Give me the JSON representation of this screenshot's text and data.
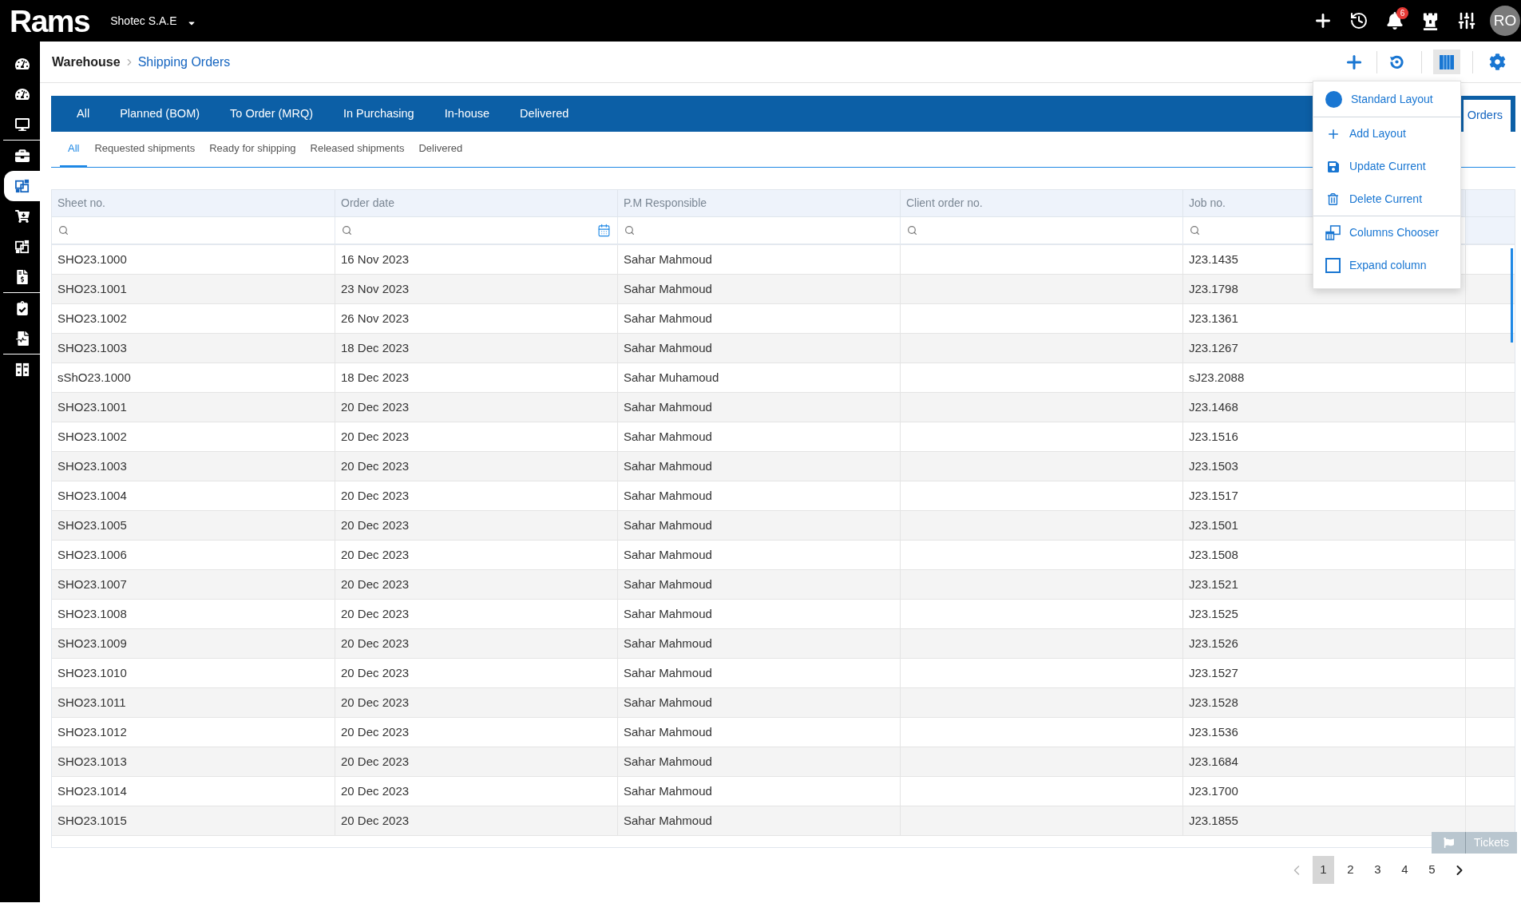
{
  "top_bar": {
    "logo": "Rams",
    "company": "Shotec S.A.E",
    "notifications_badge": "6",
    "avatar_initials": "RO"
  },
  "sidebar": {
    "groups": [
      {
        "items": [
          {
            "selected": false
          },
          {
            "selected": false
          },
          {
            "selected": false
          }
        ]
      },
      {
        "items": [
          {
            "selected": false
          },
          {
            "selected": true
          },
          {
            "selected": false
          },
          {
            "selected": false
          },
          {
            "selected": false
          }
        ]
      },
      {
        "items": [
          {
            "selected": false
          },
          {
            "selected": false
          }
        ]
      },
      {
        "items": [
          {
            "selected": false
          }
        ]
      }
    ]
  },
  "breadcrumb": [
    "Warehouse",
    "Shipping Orders"
  ],
  "status_tabs": [
    {
      "label": "All",
      "selected": false
    },
    {
      "label": "Planned (BOM)",
      "selected": false
    },
    {
      "label": "To Order (MRQ)",
      "selected": false
    },
    {
      "label": "In Purchasing",
      "selected": false
    },
    {
      "label": "In-house",
      "selected": false
    },
    {
      "label": "Delivered",
      "selected": false
    },
    {
      "label": "Orders",
      "selected": true
    }
  ],
  "sub_tabs": [
    {
      "label": "All",
      "selected": true
    },
    {
      "label": "Requested shipments",
      "selected": false
    },
    {
      "label": "Ready for shipping",
      "selected": false
    },
    {
      "label": "Released shipments",
      "selected": false
    },
    {
      "label": "Delivered",
      "selected": false
    }
  ],
  "table": {
    "columns": [
      "Sheet no.",
      "Order date",
      "P.M Responsible",
      "Client order no.",
      "Job no."
    ],
    "rows": [
      {
        "sheet_no": "SHO23.1000",
        "order_date": "16 Nov 2023",
        "pm_responsible": "Sahar Mahmoud",
        "job_no": "J23.1435"
      },
      {
        "sheet_no": "SHO23.1001",
        "order_date": "23 Nov 2023",
        "pm_responsible": "Sahar Mahmoud",
        "job_no": "J23.1798"
      },
      {
        "sheet_no": "SHO23.1002",
        "order_date": "26 Nov 2023",
        "pm_responsible": "Sahar Mahmoud",
        "job_no": "J23.1361"
      },
      {
        "sheet_no": "SHO23.1003",
        "order_date": "18 Dec 2023",
        "pm_responsible": "Sahar Mahmoud",
        "job_no": "J23.1267"
      },
      {
        "sheet_no": "sShO23.1000",
        "order_date": "18 Dec 2023",
        "pm_responsible": "Sahar Muhamoud",
        "job_no": "sJ23.2088"
      },
      {
        "sheet_no": "SHO23.1001",
        "order_date": "20 Dec 2023",
        "pm_responsible": "Sahar Mahmoud",
        "job_no": "J23.1468"
      },
      {
        "sheet_no": "SHO23.1002",
        "order_date": "20 Dec 2023",
        "pm_responsible": "Sahar Mahmoud",
        "job_no": "J23.1516"
      },
      {
        "sheet_no": "SHO23.1003",
        "order_date": "20 Dec 2023",
        "pm_responsible": "Sahar Mahmoud",
        "job_no": "J23.1503"
      },
      {
        "sheet_no": "SHO23.1004",
        "order_date": "20 Dec 2023",
        "pm_responsible": "Sahar Mahmoud",
        "job_no": "J23.1517"
      },
      {
        "sheet_no": "SHO23.1005",
        "order_date": "20 Dec 2023",
        "pm_responsible": "Sahar Mahmoud",
        "job_no": "J23.1501"
      },
      {
        "sheet_no": "SHO23.1006",
        "order_date": "20 Dec 2023",
        "pm_responsible": "Sahar Mahmoud",
        "job_no": "J23.1508"
      },
      {
        "sheet_no": "SHO23.1007",
        "order_date": "20 Dec 2023",
        "pm_responsible": "Sahar Mahmoud",
        "job_no": "J23.1521"
      },
      {
        "sheet_no": "SHO23.1008",
        "order_date": "20 Dec 2023",
        "pm_responsible": "Sahar Mahmoud",
        "job_no": "J23.1525"
      },
      {
        "sheet_no": "SHO23.1009",
        "order_date": "20 Dec 2023",
        "pm_responsible": "Sahar Mahmoud",
        "job_no": "J23.1526"
      },
      {
        "sheet_no": "SHO23.1010",
        "order_date": "20 Dec 2023",
        "pm_responsible": "Sahar Mahmoud",
        "job_no": "J23.1527"
      },
      {
        "sheet_no": "SHO23.1011",
        "order_date": "20 Dec 2023",
        "pm_responsible": "Sahar Mahmoud",
        "job_no": "J23.1528"
      },
      {
        "sheet_no": "SHO23.1012",
        "order_date": "20 Dec 2023",
        "pm_responsible": "Sahar Mahmoud",
        "job_no": "J23.1536"
      },
      {
        "sheet_no": "SHO23.1013",
        "order_date": "20 Dec 2023",
        "pm_responsible": "Sahar Mahmoud",
        "job_no": "J23.1684"
      },
      {
        "sheet_no": "SHO23.1014",
        "order_date": "20 Dec 2023",
        "pm_responsible": "Sahar Mahmoud",
        "job_no": "J23.1700"
      },
      {
        "sheet_no": "SHO23.1015",
        "order_date": "20 Dec 2023",
        "pm_responsible": "Sahar Mahmoud",
        "job_no": "J23.1855"
      }
    ]
  },
  "pagination": {
    "previous": {
      "disabled": true
    },
    "pages": [
      {
        "label": "1",
        "selected": true
      },
      {
        "label": "2",
        "selected": false
      },
      {
        "label": "3",
        "selected": false
      },
      {
        "label": "4",
        "selected": false
      },
      {
        "label": "5",
        "selected": false
      }
    ],
    "next": {
      "disabled": false
    }
  },
  "tickets_button": {
    "label": "Tickets"
  },
  "layout_menu": {
    "open": true,
    "sections": [
      {
        "items": [
          {
            "kind": "radio",
            "label": "Standard Layout",
            "selected": true
          }
        ]
      },
      {
        "items": [
          {
            "kind": "command",
            "label": "Add Layout"
          },
          {
            "kind": "command",
            "label": "Update Current"
          },
          {
            "kind": "command",
            "label": "Delete Current"
          }
        ]
      },
      {
        "items": [
          {
            "kind": "command",
            "label": "Columns Chooser"
          },
          {
            "kind": "checkbox",
            "label": "Expand column",
            "checked": false
          }
        ]
      }
    ]
  }
}
